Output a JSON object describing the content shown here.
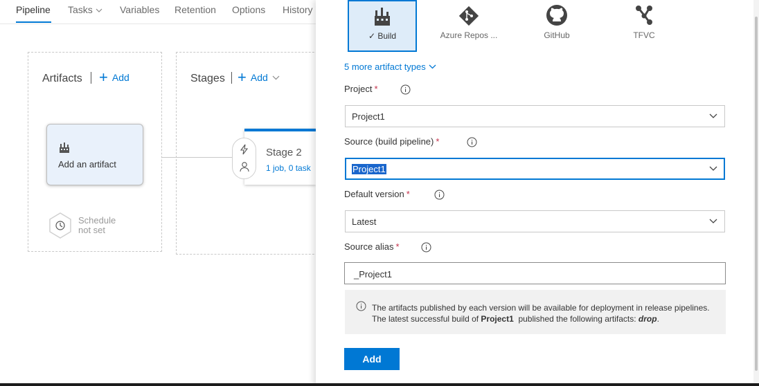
{
  "tabs": [
    {
      "label": "Pipeline"
    },
    {
      "label": "Tasks"
    },
    {
      "label": "Variables"
    },
    {
      "label": "Retention"
    },
    {
      "label": "Options"
    },
    {
      "label": "History"
    }
  ],
  "artifacts": {
    "title": "Artifacts",
    "add_label": "Add",
    "card_label": "Add an artifact",
    "schedule_line1": "Schedule",
    "schedule_line2": "not set"
  },
  "stages": {
    "title": "Stages",
    "add_label": "Add",
    "stage_name": "Stage 2",
    "stage_summary": "1 job, 0 task"
  },
  "panel": {
    "source_types": [
      {
        "label": "Build",
        "icon": "build-icon",
        "selected": true
      },
      {
        "label": "Azure Repos ...",
        "icon": "git-icon",
        "selected": false
      },
      {
        "label": "GitHub",
        "icon": "github-icon",
        "selected": false
      },
      {
        "label": "TFVC",
        "icon": "tfvc-icon",
        "selected": false
      }
    ],
    "more_types": "5 more artifact types",
    "project_label": "Project",
    "project_value": "Project1",
    "source_label": "Source (build pipeline)",
    "source_value": "Project1",
    "default_version_label": "Default version",
    "default_version_value": "Latest",
    "alias_label": "Source alias",
    "alias_value": "_Project1",
    "required_mark": "*",
    "note_line1": "The artifacts published by each version will be available for deployment in release pipelines.",
    "note_line2_prefix": "The latest successful build of",
    "note_line2_project": "Project1",
    "note_line2_mid": "published the following artifacts:",
    "note_line2_artifact": "drop",
    "note_line2_end": ".",
    "add_button": "Add"
  },
  "colors": {
    "accent": "#0078d4",
    "required": "#c4314b",
    "selected_bg": "#deecf9",
    "note_bg": "#f1f1f1"
  }
}
